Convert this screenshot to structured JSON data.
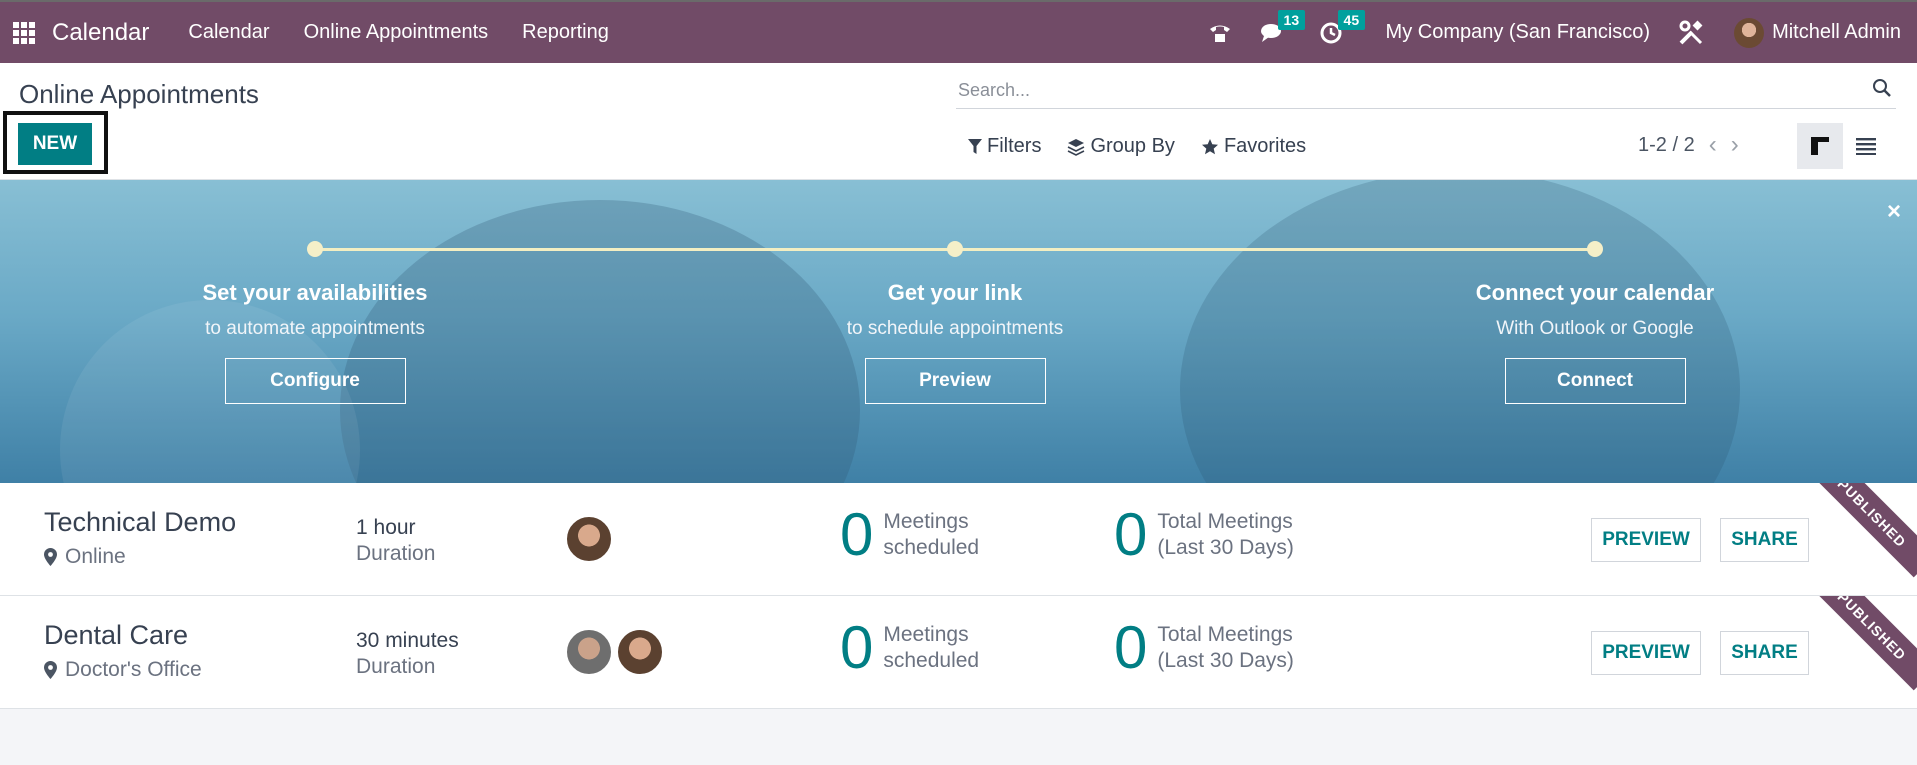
{
  "navbar": {
    "app_name": "Calendar",
    "menu": [
      "Calendar",
      "Online Appointments",
      "Reporting"
    ],
    "messages_count": "13",
    "activities_count": "45",
    "company": "My Company (San Francisco)",
    "user": "Mitchell Admin"
  },
  "control": {
    "title": "Online Appointments",
    "new_label": "NEW",
    "search_placeholder": "Search...",
    "filters_label": "Filters",
    "groupby_label": "Group By",
    "favorites_label": "Favorites",
    "pager": "1-2 / 2"
  },
  "banner": {
    "steps": [
      {
        "title": "Set your availabilities",
        "subtitle": "to automate appointments",
        "button": "Configure"
      },
      {
        "title": "Get your link",
        "subtitle": "to schedule appointments",
        "button": "Preview"
      },
      {
        "title": "Connect your calendar",
        "subtitle": "With Outlook or Google",
        "button": "Connect"
      }
    ],
    "close": "×"
  },
  "rows": [
    {
      "name": "Technical Demo",
      "location": "Online",
      "duration": "1 hour",
      "duration_label": "Duration",
      "meetings_num": "0",
      "meetings_label_1": "Meetings",
      "meetings_label_2": "scheduled",
      "total_num": "0",
      "total_label_1": "Total Meetings",
      "total_label_2": "(Last 30 Days)",
      "preview": "PREVIEW",
      "share": "SHARE",
      "ribbon": "PUBLISHED"
    },
    {
      "name": "Dental Care",
      "location": "Doctor's Office",
      "duration": "30 minutes",
      "duration_label": "Duration",
      "meetings_num": "0",
      "meetings_label_1": "Meetings",
      "meetings_label_2": "scheduled",
      "total_num": "0",
      "total_label_1": "Total Meetings",
      "total_label_2": "(Last 30 Days)",
      "preview": "PREVIEW",
      "share": "SHARE",
      "ribbon": "PUBLISHED"
    }
  ],
  "colors": {
    "brand": "#714b67",
    "accent": "#017e84",
    "badge": "#00a09d"
  }
}
